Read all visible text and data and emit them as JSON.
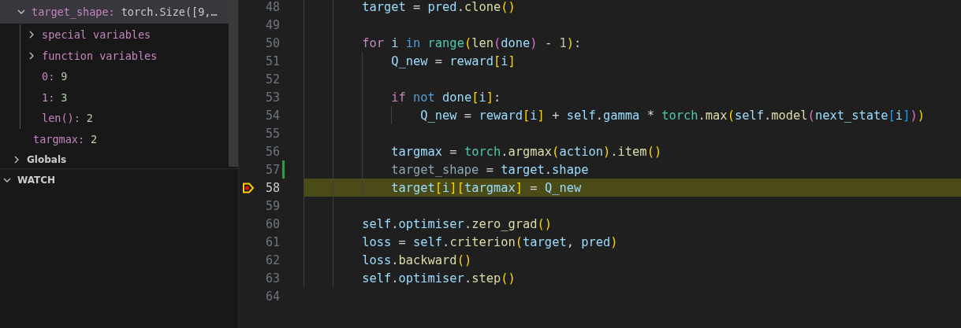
{
  "variables": {
    "items": [
      {
        "name": "target_shape:",
        "value": "torch.Size([9,…",
        "expanded": true,
        "selected": true,
        "children": [
          {
            "kind": "group",
            "name": "special variables",
            "expanded": false
          },
          {
            "kind": "group",
            "name": "function variables",
            "expanded": false
          },
          {
            "kind": "value",
            "name": "0:",
            "value": "9"
          },
          {
            "kind": "value",
            "name": "1:",
            "value": "3"
          },
          {
            "kind": "value",
            "name": "len():",
            "value": "2"
          }
        ]
      },
      {
        "name": "targmax:",
        "value": "2",
        "selected": false
      }
    ],
    "scopes": [
      {
        "label": "Globals",
        "expanded": false
      }
    ]
  },
  "watch": {
    "label": "WATCH",
    "expanded": true
  },
  "editor": {
    "lines": [
      {
        "number": "48",
        "spans": [
          {
            "text": "        target ",
            "color": "#9cdcfe"
          },
          {
            "text": "= "
          },
          {
            "text": "pred",
            "color": "#9cdcfe"
          },
          {
            "text": "."
          },
          {
            "text": "clone",
            "color": "#dcdcaa"
          },
          {
            "text": "()",
            "color": "#ffd700"
          }
        ]
      },
      {
        "number": "49"
      },
      {
        "number": "50",
        "spans": [
          {
            "text": "        for ",
            "color": "#c586c0"
          },
          {
            "text": "i ",
            "color": "#9cdcfe"
          },
          {
            "text": "in ",
            "color": "#569cd6"
          },
          {
            "text": "range",
            "color": "#4ec9b0"
          },
          {
            "text": "(",
            "color": "#ffd700"
          },
          {
            "text": "len",
            "color": "#dcdcaa"
          },
          {
            "text": "(",
            "color": "#da70d6"
          },
          {
            "text": "done",
            "color": "#9cdcfe"
          },
          {
            "text": ")",
            "color": "#da70d6"
          },
          {
            "text": " - "
          },
          {
            "text": "1",
            "color": "#b5cea8"
          },
          {
            "text": ")",
            "color": "#ffd700"
          },
          {
            "text": ":"
          }
        ]
      },
      {
        "number": "51",
        "spans": [
          {
            "text": "            Q_new ",
            "color": "#9cdcfe"
          },
          {
            "text": "= "
          },
          {
            "text": "reward",
            "color": "#9cdcfe"
          },
          {
            "text": "[",
            "color": "#ffd700"
          },
          {
            "text": "i",
            "color": "#9cdcfe"
          },
          {
            "text": "]",
            "color": "#ffd700"
          }
        ]
      },
      {
        "number": "52"
      },
      {
        "number": "53",
        "spans": [
          {
            "text": "            if ",
            "color": "#c586c0"
          },
          {
            "text": "not ",
            "color": "#569cd6"
          },
          {
            "text": "done",
            "color": "#9cdcfe"
          },
          {
            "text": "[",
            "color": "#ffd700"
          },
          {
            "text": "i",
            "color": "#9cdcfe"
          },
          {
            "text": "]",
            "color": "#ffd700"
          },
          {
            "text": ":"
          }
        ]
      },
      {
        "number": "54",
        "spans": [
          {
            "text": "                Q_new ",
            "color": "#9cdcfe"
          },
          {
            "text": "= "
          },
          {
            "text": "reward",
            "color": "#9cdcfe"
          },
          {
            "text": "[",
            "color": "#ffd700"
          },
          {
            "text": "i",
            "color": "#9cdcfe"
          },
          {
            "text": "]",
            "color": "#ffd700"
          },
          {
            "text": " + "
          },
          {
            "text": "self",
            "color": "#9cdcfe"
          },
          {
            "text": "."
          },
          {
            "text": "gamma",
            "color": "#9cdcfe"
          },
          {
            "text": " * "
          },
          {
            "text": "torch",
            "color": "#4ec9b0"
          },
          {
            "text": "."
          },
          {
            "text": "max",
            "color": "#dcdcaa"
          },
          {
            "text": "(",
            "color": "#ffd700"
          },
          {
            "text": "self",
            "color": "#9cdcfe"
          },
          {
            "text": "."
          },
          {
            "text": "model",
            "color": "#dcdcaa"
          },
          {
            "text": "(",
            "color": "#da70d6"
          },
          {
            "text": "next_state",
            "color": "#9cdcfe"
          },
          {
            "text": "[",
            "color": "#179fff"
          },
          {
            "text": "i",
            "color": "#9cdcfe"
          },
          {
            "text": "]",
            "color": "#179fff"
          },
          {
            "text": ")",
            "color": "#da70d6"
          },
          {
            "text": ")",
            "color": "#ffd700"
          }
        ]
      },
      {
        "number": "55"
      },
      {
        "number": "56",
        "spans": [
          {
            "text": "            targmax ",
            "color": "#9cdcfe"
          },
          {
            "text": "= "
          },
          {
            "text": "torch",
            "color": "#4ec9b0"
          },
          {
            "text": "."
          },
          {
            "text": "argmax",
            "color": "#dcdcaa"
          },
          {
            "text": "(",
            "color": "#ffd700"
          },
          {
            "text": "action",
            "color": "#9cdcfe"
          },
          {
            "text": ")",
            "color": "#ffd700"
          },
          {
            "text": "."
          },
          {
            "text": "item",
            "color": "#dcdcaa"
          },
          {
            "text": "()",
            "color": "#ffd700"
          }
        ]
      },
      {
        "number": "57",
        "modified": true,
        "spans": [
          {
            "text": "            target_shape ",
            "color": "#8fa8b5"
          },
          {
            "text": "= "
          },
          {
            "text": "target",
            "color": "#9cdcfe"
          },
          {
            "text": "."
          },
          {
            "text": "shape",
            "color": "#9cdcfe"
          }
        ]
      },
      {
        "number": "58",
        "current": true,
        "breakpoint": true,
        "spans": [
          {
            "text": "            target",
            "color": "#9cdcfe"
          },
          {
            "text": "[",
            "color": "#ffd700"
          },
          {
            "text": "i",
            "color": "#9cdcfe"
          },
          {
            "text": "][",
            "color": "#ffd700"
          },
          {
            "text": "targmax",
            "color": "#9cdcfe"
          },
          {
            "text": "]",
            "color": "#ffd700"
          },
          {
            "text": " = "
          },
          {
            "text": "Q_new",
            "color": "#9cdcfe"
          }
        ]
      },
      {
        "number": "59"
      },
      {
        "number": "60",
        "spans": [
          {
            "text": "        self",
            "color": "#9cdcfe"
          },
          {
            "text": "."
          },
          {
            "text": "optimiser",
            "color": "#9cdcfe"
          },
          {
            "text": "."
          },
          {
            "text": "zero_grad",
            "color": "#dcdcaa"
          },
          {
            "text": "()",
            "color": "#ffd700"
          }
        ]
      },
      {
        "number": "61",
        "spans": [
          {
            "text": "        loss ",
            "color": "#9cdcfe"
          },
          {
            "text": "= "
          },
          {
            "text": "self",
            "color": "#9cdcfe"
          },
          {
            "text": "."
          },
          {
            "text": "criterion",
            "color": "#dcdcaa"
          },
          {
            "text": "(",
            "color": "#ffd700"
          },
          {
            "text": "target",
            "color": "#9cdcfe"
          },
          {
            "text": ", "
          },
          {
            "text": "pred",
            "color": "#9cdcfe"
          },
          {
            "text": ")",
            "color": "#ffd700"
          }
        ]
      },
      {
        "number": "62",
        "spans": [
          {
            "text": "        loss",
            "color": "#9cdcfe"
          },
          {
            "text": "."
          },
          {
            "text": "backward",
            "color": "#dcdcaa"
          },
          {
            "text": "()",
            "color": "#ffd700"
          }
        ]
      },
      {
        "number": "63",
        "spans": [
          {
            "text": "        self",
            "color": "#9cdcfe"
          },
          {
            "text": "."
          },
          {
            "text": "optimiser",
            "color": "#9cdcfe"
          },
          {
            "text": "."
          },
          {
            "text": "step",
            "color": "#dcdcaa"
          },
          {
            "text": "()",
            "color": "#ffd700"
          }
        ]
      },
      {
        "number": "64"
      }
    ]
  }
}
